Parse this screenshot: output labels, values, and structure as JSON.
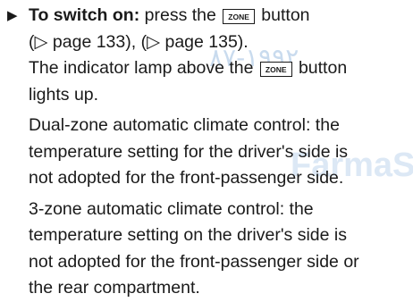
{
  "watermark": {
    "arabic": "١٩٩٢-٨٧",
    "latin": "FarmaS"
  },
  "step": {
    "arrow_icon": "triangle-right-icon",
    "lead": "To switch on:",
    "text_part_1": " press the ",
    "key_label": "ZONE",
    "text_part_2": " button",
    "line_2": "(▷ page 133), (▷ page 135).",
    "line_3_part_1": "The indicator lamp above the ",
    "line_3_part_2": " button",
    "line_4": "lights up."
  },
  "paragraphs": [
    {
      "lines": [
        "Dual-zone automatic climate control: the",
        "temperature setting for the driver's side is",
        "not adopted for the front-passenger side."
      ]
    },
    {
      "lines": [
        "3-zone automatic climate control: the",
        "temperature setting on the driver's side is",
        "not adopted for the front-passenger side or",
        "the rear compartment."
      ]
    }
  ]
}
